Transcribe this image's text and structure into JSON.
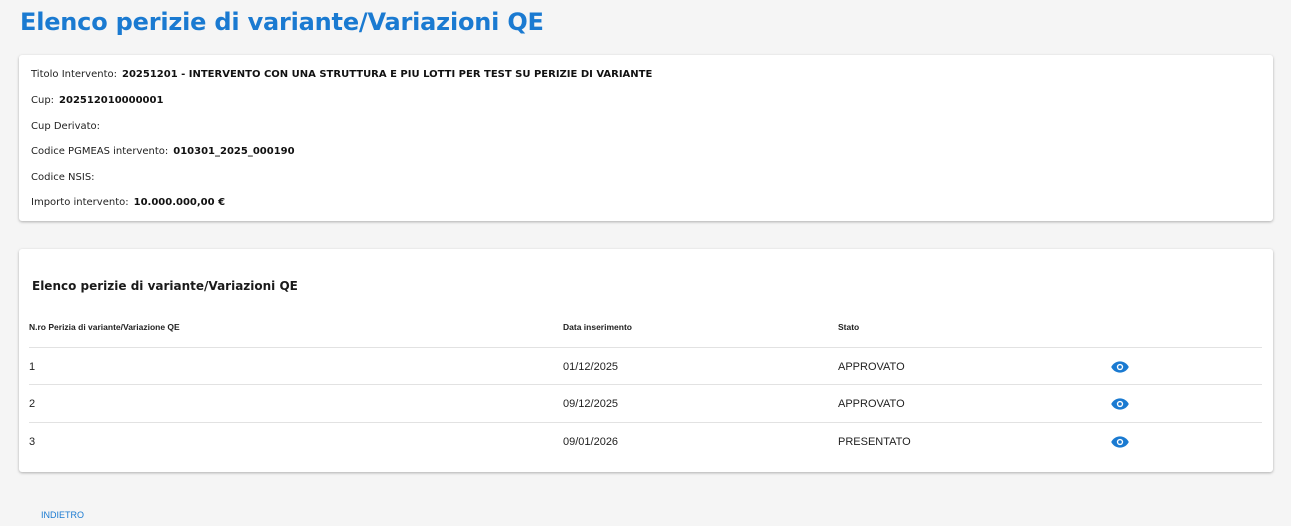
{
  "page": {
    "title": "Elenco perizie di variante/Variazioni QE"
  },
  "intervento": {
    "titolo_label": "Titolo Intervento:",
    "titolo_value": "20251201 - INTERVENTO CON UNA STRUTTURA E PIU LOTTI PER TEST SU PERIZIE DI VARIANTE",
    "cup_label": "Cup:",
    "cup_value": "202512010000001",
    "cup_derivato_label": "Cup Derivato:",
    "cup_derivato_value": "",
    "pgmeas_label": "Codice PGMEAS intervento:",
    "pgmeas_value": "010301_2025_000190",
    "nsis_label": "Codice NSIS:",
    "nsis_value": "",
    "importo_label": "Importo intervento:",
    "importo_value": "10.000.000,00 €"
  },
  "list": {
    "title": "Elenco perizie di variante/Variazioni QE",
    "headers": {
      "numero": "N.ro Perizia di variante/Variazione QE",
      "data": "Data inserimento",
      "stato": "Stato"
    },
    "rows": [
      {
        "numero": "1",
        "data": "01/12/2025",
        "stato": "APPROVATO",
        "action_icon": "eye-icon"
      },
      {
        "numero": "2",
        "data": "09/12/2025",
        "stato": "APPROVATO",
        "action_icon": "eye-icon"
      },
      {
        "numero": "3",
        "data": "09/01/2026",
        "stato": "PRESENTATO",
        "action_icon": "eye-icon"
      }
    ]
  },
  "footer": {
    "back_label": "INDIETRO"
  },
  "colors": {
    "accent": "#1a7ad1",
    "background": "#f5f5f5",
    "card": "#ffffff"
  }
}
